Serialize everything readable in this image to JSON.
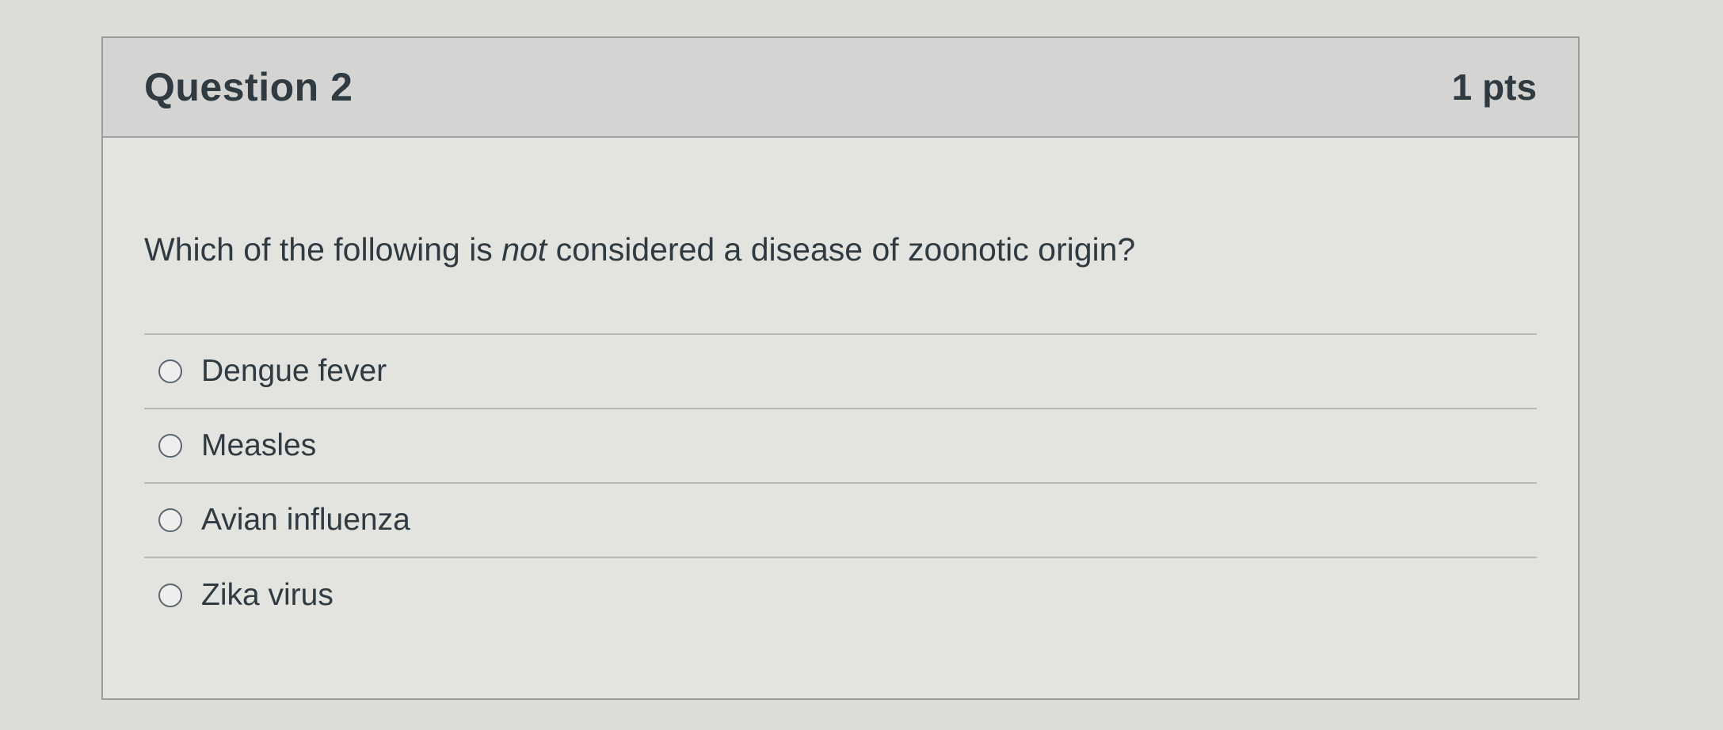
{
  "question": {
    "title": "Question 2",
    "points": "1 pts",
    "text_before": "Which of the following is ",
    "text_emphasis": "not",
    "text_after": " considered a disease of zoonotic origin?",
    "answers": [
      {
        "label": "Dengue fever",
        "selected": false
      },
      {
        "label": "Measles",
        "selected": false
      },
      {
        "label": "Avian influenza",
        "selected": false
      },
      {
        "label": "Zika virus",
        "selected": false
      }
    ]
  }
}
